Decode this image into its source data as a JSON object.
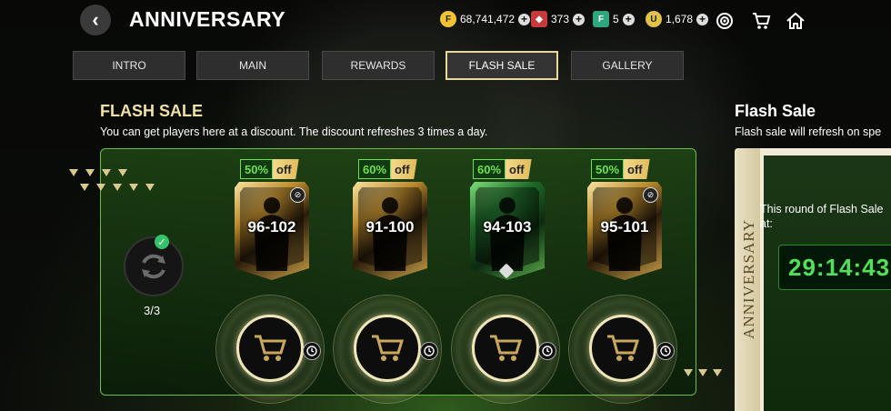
{
  "header": {
    "title": "ANNIVERSARY"
  },
  "currencies": [
    {
      "name": "fc-points",
      "value": "68,741,472",
      "color": "#f1c232"
    },
    {
      "name": "gems",
      "value": "373",
      "color": "#e64a4a"
    },
    {
      "name": "tokens",
      "value": "5",
      "color": "#3fd6a0"
    },
    {
      "name": "coins",
      "value": "1,678",
      "color": "#e0c14a"
    }
  ],
  "tabs": [
    {
      "label": "INTRO",
      "active": false
    },
    {
      "label": "MAIN",
      "active": false
    },
    {
      "label": "REWARDS",
      "active": false
    },
    {
      "label": "FLASH SALE",
      "active": true
    },
    {
      "label": "GALLERY",
      "active": false
    }
  ],
  "flash": {
    "title": "FLASH SALE",
    "subtitle": "You can get players here at a discount. The discount refreshes 3 times a day.",
    "refresh_count": "3/3",
    "cards": [
      {
        "discount": "50%",
        "off": "off",
        "rating": "96-102",
        "style": "gold",
        "badge": "no-trade-icon"
      },
      {
        "discount": "60%",
        "off": "off",
        "rating": "91-100",
        "style": "gold",
        "badge": ""
      },
      {
        "discount": "60%",
        "off": "off",
        "rating": "94-103",
        "style": "green",
        "badge": "gem-icon"
      },
      {
        "discount": "50%",
        "off": "off",
        "rating": "95-101",
        "style": "gold",
        "badge": "no-trade-icon"
      }
    ]
  },
  "side": {
    "title": "Flash Sale",
    "subtitle": "Flash sale will refresh on spe",
    "vertical_label": "ANNIVERSARY",
    "round_label_1": "This round of Flash Sale",
    "round_label_2": "at:",
    "timer": "29:14:43"
  },
  "colors": {
    "accent_gold": "#f2e2a5",
    "accent_green": "#6fe04a"
  }
}
